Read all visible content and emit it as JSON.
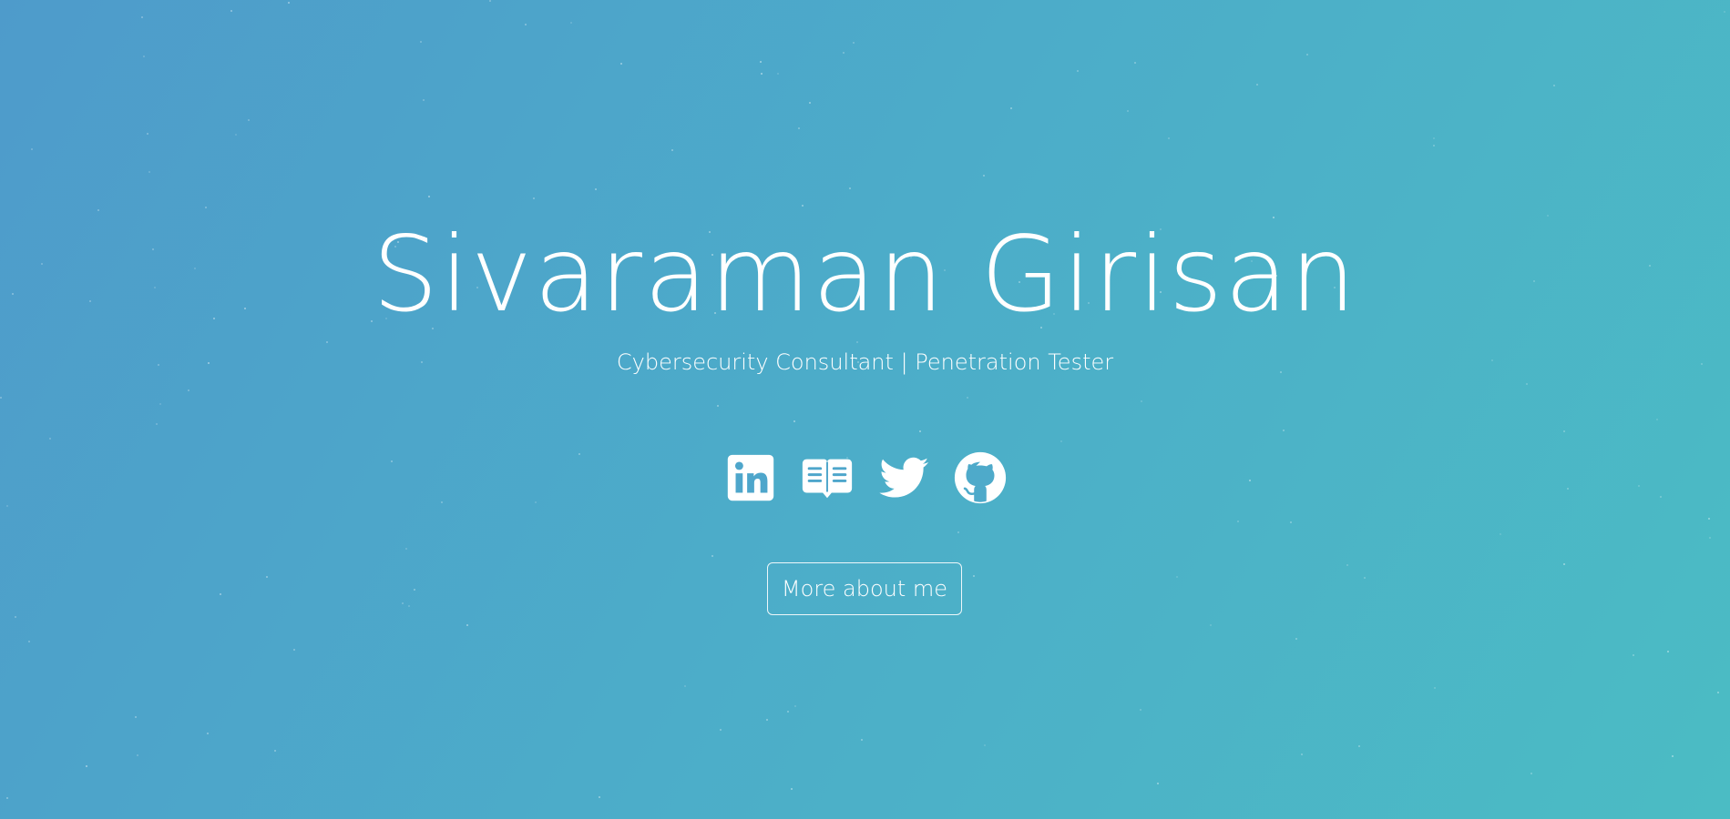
{
  "hero": {
    "name": "Sivaraman Girisan",
    "subtitle": "Cybersecurity Consultant | Penetration Tester"
  },
  "social_links": [
    {
      "icon": "linkedin-icon"
    },
    {
      "icon": "blog-icon"
    },
    {
      "icon": "twitter-icon"
    },
    {
      "icon": "github-icon"
    }
  ],
  "cta": {
    "label": "More about me"
  },
  "colors": {
    "background_start": "#4e9bcb",
    "background_end": "#4bbcc4",
    "text": "#ffffff"
  }
}
